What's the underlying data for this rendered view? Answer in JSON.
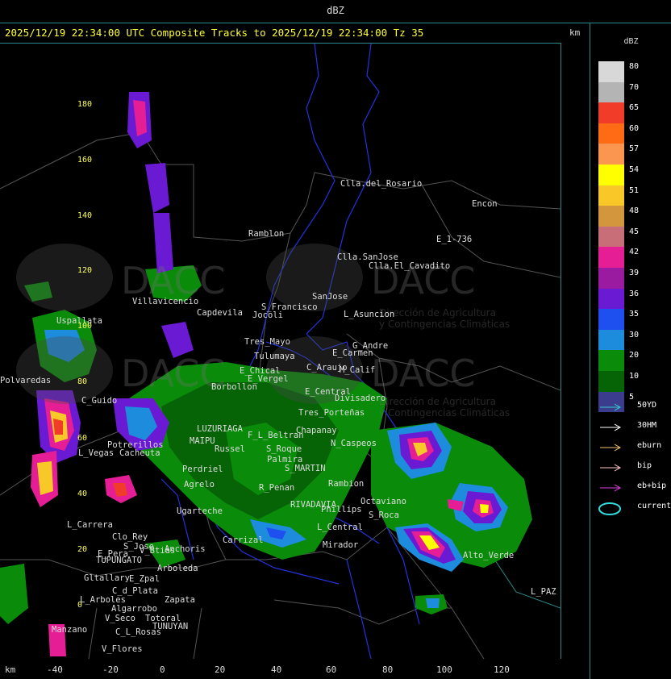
{
  "window": {
    "title": "dBZ"
  },
  "header": {
    "text": "2025/12/19 22:34:00 UTC Composite Tracks to 2025/12/19 22:34:00 Tz 35",
    "km_label": "km"
  },
  "axes": {
    "x_label": "km",
    "x_ticks": [
      "-40",
      "-20",
      "0",
      "20",
      "40",
      "60",
      "80",
      "100",
      "120"
    ],
    "y_ticks": [
      "180",
      "160",
      "140",
      "120",
      "100",
      "80",
      "60",
      "40",
      "20",
      "0"
    ]
  },
  "legend": {
    "title": "dBZ",
    "scale": [
      {
        "label": "80",
        "color": "#d8d8d8"
      },
      {
        "label": "70",
        "color": "#b4b4b4"
      },
      {
        "label": "65",
        "color": "#f03c28"
      },
      {
        "label": "60",
        "color": "#ff6a14"
      },
      {
        "label": "57",
        "color": "#fa9650"
      },
      {
        "label": "54",
        "color": "#ffff00"
      },
      {
        "label": "51",
        "color": "#f8c828"
      },
      {
        "label": "48",
        "color": "#d4963c"
      },
      {
        "label": "45",
        "color": "#c86e78"
      },
      {
        "label": "42",
        "color": "#e61e96"
      },
      {
        "label": "39",
        "color": "#9a1aa0"
      },
      {
        "label": "36",
        "color": "#6a1ad2"
      },
      {
        "label": "35",
        "color": "#1e50f0"
      },
      {
        "label": "30",
        "color": "#1e8cdc"
      },
      {
        "label": "20",
        "color": "#0a8c0a"
      },
      {
        "label": "10",
        "color": "#066406"
      },
      {
        "label": "5",
        "color": "#3c3c8c"
      }
    ],
    "tracks": [
      {
        "label": "50YD",
        "color": "#33cccc"
      },
      {
        "label": "30HM",
        "color": "#ffffff"
      },
      {
        "label": "eburn",
        "color": "#f0c070"
      },
      {
        "label": "bip",
        "color": "#ffc8c8"
      },
      {
        "label": "eb+bip",
        "color": "#e040e0"
      },
      {
        "label": "current",
        "color": "#33dddd"
      }
    ]
  },
  "watermark": {
    "brand": "DACC",
    "subtitle_line1": "Dirección de Agricultura",
    "subtitle_line2": "y Contingencias Climáticas"
  },
  "places": [
    {
      "name": "Clla.del_Rosario"
    },
    {
      "name": "Encon"
    },
    {
      "name": "E_1-736"
    },
    {
      "name": "Ramblon"
    },
    {
      "name": "Clla.SanJose"
    },
    {
      "name": "Clla.El_Cavadito"
    },
    {
      "name": "SanJose"
    },
    {
      "name": "S_Francisco"
    },
    {
      "name": "Villavicencio"
    },
    {
      "name": "Capdevila"
    },
    {
      "name": "Jocoli"
    },
    {
      "name": "L_Asuncion"
    },
    {
      "name": "Uspallata"
    },
    {
      "name": "Tres_Mayo"
    },
    {
      "name": "G_Andre"
    },
    {
      "name": "Tulumaya"
    },
    {
      "name": "E_Carmen"
    },
    {
      "name": "C_Araujo"
    },
    {
      "name": "Polvaredas"
    },
    {
      "name": "Potrerillos"
    },
    {
      "name": "L_Vegas"
    },
    {
      "name": "Cacheuta"
    },
    {
      "name": "C_Guido"
    },
    {
      "name": "Borbollon"
    },
    {
      "name": "E_Chical"
    },
    {
      "name": "E_Vergel"
    },
    {
      "name": "Tres_Porteñas"
    },
    {
      "name": "Divisadero"
    },
    {
      "name": "E_Central"
    },
    {
      "name": "LUZURIAGA"
    },
    {
      "name": "MAIPU"
    },
    {
      "name": "Russel"
    },
    {
      "name": "Perdriel"
    },
    {
      "name": "Agrelo"
    },
    {
      "name": "F_L_Beltran"
    },
    {
      "name": "S_Roque"
    },
    {
      "name": "Palmira"
    },
    {
      "name": "S_MARTIN"
    },
    {
      "name": "Rambion"
    },
    {
      "name": "R_Penan"
    },
    {
      "name": "RIVADAVIA"
    },
    {
      "name": "Phillips"
    },
    {
      "name": "Ugarteche"
    },
    {
      "name": "L_Carrera"
    },
    {
      "name": "Clo_Rey"
    },
    {
      "name": "S_Jose"
    },
    {
      "name": "Anchoris"
    },
    {
      "name": "Carrizal"
    },
    {
      "name": "L_Central"
    },
    {
      "name": "Mirador"
    },
    {
      "name": "E_Pera"
    },
    {
      "name": "TUPUNGATO"
    },
    {
      "name": "V_Btias"
    },
    {
      "name": "Arboleda"
    },
    {
      "name": "Gltallary"
    },
    {
      "name": "E_Zpal"
    },
    {
      "name": "C_d_Plata"
    },
    {
      "name": "Zapata"
    },
    {
      "name": "L_Arboles"
    },
    {
      "name": "Algarrobo"
    },
    {
      "name": "V_Seco"
    },
    {
      "name": "Totoral"
    },
    {
      "name": "TUNUYAN"
    },
    {
      "name": "Manzano"
    },
    {
      "name": "C_L_Rosas"
    },
    {
      "name": "V_Flores"
    },
    {
      "name": "L_PAZ"
    },
    {
      "name": "S_Roca"
    },
    {
      "name": "N_Caspeos"
    },
    {
      "name": "Chapanay"
    },
    {
      "name": "M_Calif"
    },
    {
      "name": "Octaviano"
    },
    {
      "name": "Alto_Verde"
    }
  ]
}
